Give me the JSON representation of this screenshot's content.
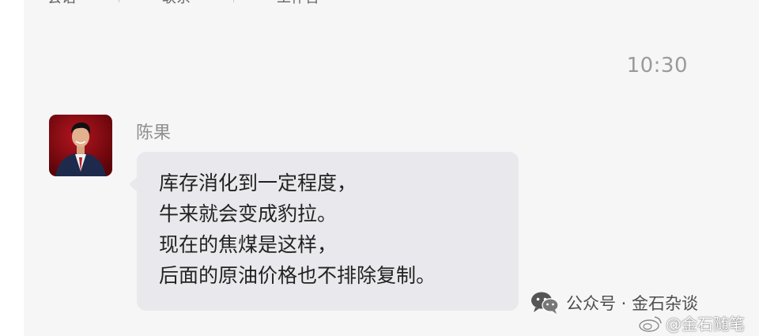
{
  "top_tabs": [
    "会话",
    "联系",
    "工作台"
  ],
  "chat": {
    "timestamp": "10:30",
    "message": {
      "sender": "陈果",
      "lines": [
        "库存消化到一定程度，",
        "牛来就会变成豹拉。",
        "现在的焦煤是这样，",
        "后面的原油价格也不排除复制。"
      ]
    }
  },
  "watermark": {
    "wechat_text": "公众号 · 金石杂谈",
    "weibo_text": "@金石随笔"
  },
  "colors": {
    "panel_bg": "#f6f6f7",
    "bubble_bg": "#e9e9ed",
    "avatar_bg": "#8b0d14"
  }
}
